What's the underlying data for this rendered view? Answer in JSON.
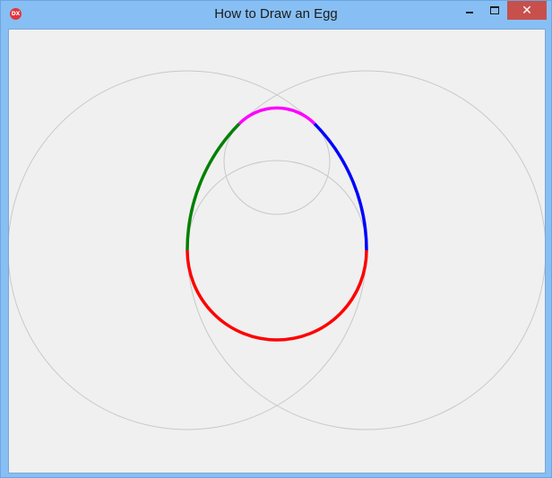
{
  "window": {
    "title": "How to Draw an Egg",
    "icon": {
      "name": "app-icon",
      "label": "DX"
    },
    "controls": {
      "minimize_icon": "minimize-icon",
      "maximize_icon": "maximize-icon",
      "close_icon": "close-icon"
    },
    "colors": {
      "titlebar": "#87bff4",
      "close_button": "#c7504c",
      "client_background": "#f0f0f0"
    }
  },
  "drawing": {
    "guide_circle_color": "#c8c8c8",
    "arc_colors": {
      "bottom": "#ff0000",
      "left": "#008000",
      "right": "#0000ff",
      "top": "#ff00ff"
    }
  }
}
